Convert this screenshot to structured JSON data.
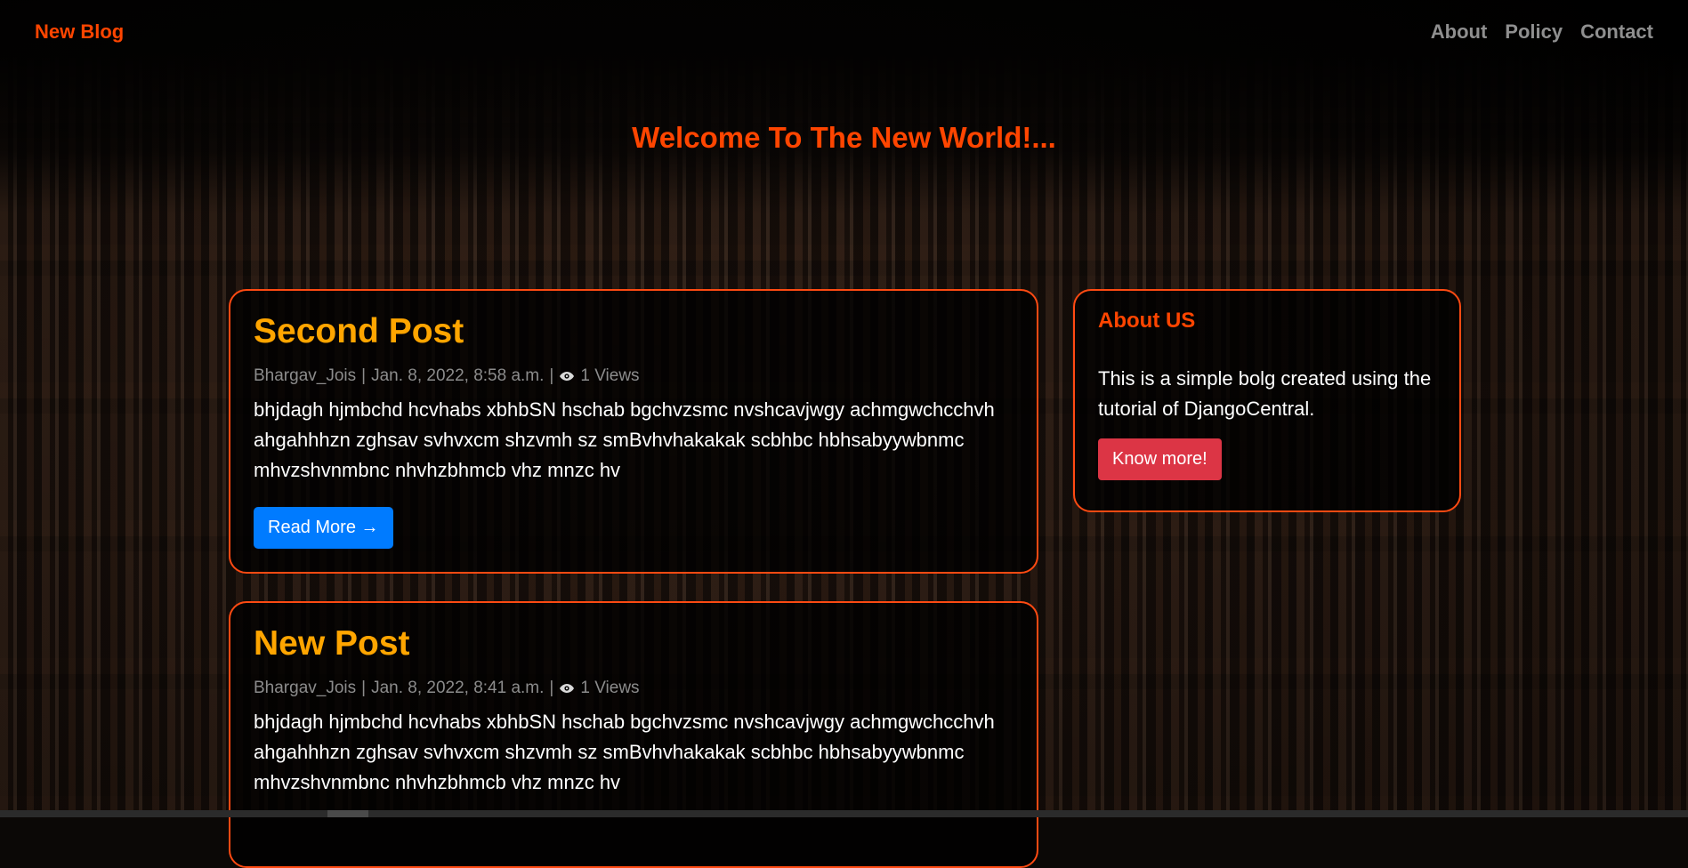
{
  "navbar": {
    "brand": "New Blog",
    "links": [
      "About",
      "Policy",
      "Contact"
    ]
  },
  "hero": {
    "title": "Welcome To The New World!..."
  },
  "posts": [
    {
      "title": "Second Post",
      "author": "Bhargav_Jois",
      "date": "Jan. 8, 2022, 8:58 a.m.",
      "views": "1 Views",
      "body": "bhjdagh hjmbchd hcvhabs xbhbSN hschab  bgchvzsmc nvshcavjwgy achmgwchcchvh ahgahhhzn zghsav svhvxcm  shzvmh sz smBvhvhakakak scbhbc hbhsabyywbnmc mhvzshvnmbnc nhvhzbhmcb  vhz mnzc hv",
      "button": "Read More →"
    },
    {
      "title": "New Post",
      "author": "Bhargav_Jois",
      "date": "Jan. 8, 2022, 8:41 a.m.",
      "views": "1 Views",
      "body": "bhjdagh hjmbchd hcvhabs xbhbSN hschab  bgchvzsmc nvshcavjwgy achmgwchcchvh ahgahhhzn zghsav svhvxcm  shzvmh sz smBvhvhakakak scbhbc hbhsabyywbnmc mhvzshvnmbnc nhvhzbhmcb  vhz mnzc hv"
    }
  ],
  "sidebar": {
    "title": "About US",
    "text": "This is a simple bolg created using the tutorial of DjangoCentral.",
    "button": "Know more!"
  },
  "icons": {
    "views": "eye-icon"
  },
  "colors": {
    "accent": "#ff4500",
    "post_title": "#ffa500",
    "primary_button": "#007bff",
    "danger_button": "#dc3545",
    "card_border": "#ff4a12"
  }
}
